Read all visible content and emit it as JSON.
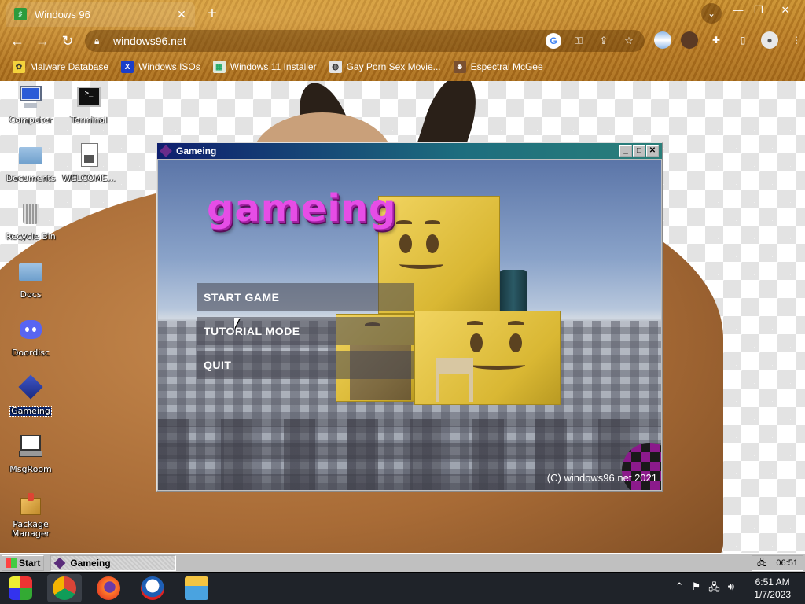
{
  "browser": {
    "tab_title": "Windows 96",
    "url": "windows96.net",
    "bookmarks": [
      {
        "label": "Malware Database",
        "color": "#f4d23c"
      },
      {
        "label": "Windows ISOs",
        "color": "#1a3ec9"
      },
      {
        "label": "Windows 11 Installer",
        "color": "#dfe9df"
      },
      {
        "label": "Gay Porn Sex Movie...",
        "color": "#e4e4e4"
      },
      {
        "label": "Espectral McGee",
        "color": "#7a5030"
      }
    ]
  },
  "desktop": {
    "icons": [
      {
        "label": "Computer"
      },
      {
        "label": "Terminal"
      },
      {
        "label": "Documents"
      },
      {
        "label": "WELCOME..."
      },
      {
        "label": "Recycle Bin"
      },
      {
        "label": "Docs"
      },
      {
        "label": "Doordisc"
      },
      {
        "label": "Gameing"
      },
      {
        "label": "MsgRoom"
      },
      {
        "label": "Package Manager"
      }
    ]
  },
  "game_window": {
    "title": "Gameing",
    "logo": "gameing",
    "menu": [
      "START GAME",
      "TUTORIAL MODE",
      "QUIT"
    ],
    "copyright": "(C) windows96.net 2021"
  },
  "w96_taskbar": {
    "start_label": "Start",
    "task_label": "Gameing",
    "tray_time": "06:51"
  },
  "windows_taskbar": {
    "time": "6:51 AM",
    "date": "1/7/2023"
  }
}
